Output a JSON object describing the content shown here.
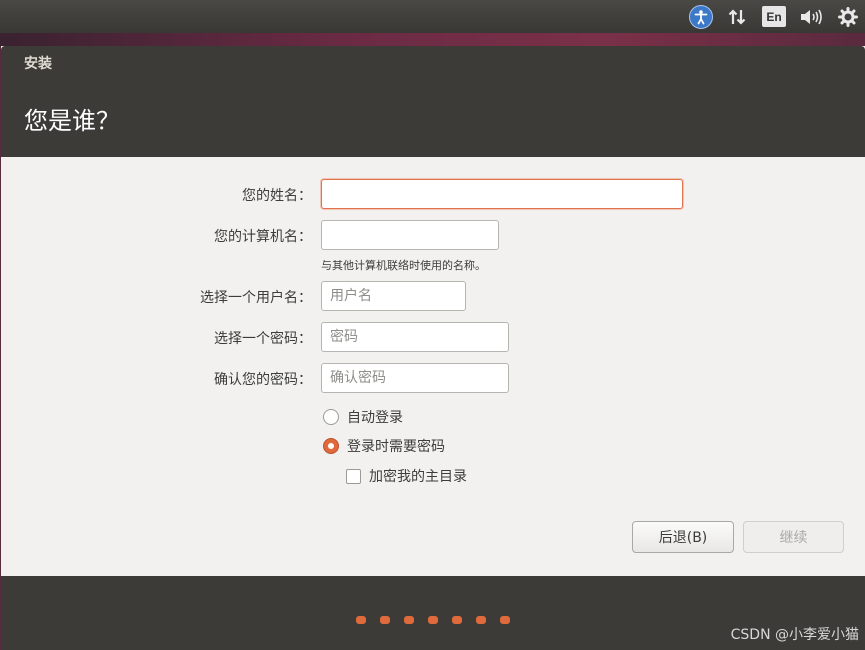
{
  "panel": {
    "keyboard_layout": "En",
    "icons": [
      "accessibility-icon",
      "network-icon",
      "keyboard-icon",
      "volume-icon",
      "gear-icon"
    ]
  },
  "window": {
    "title": "安装",
    "page_title": "您是谁？"
  },
  "form": {
    "name_label": "您的姓名：",
    "name_value": "",
    "computer_label": "您的计算机名：",
    "computer_value": "",
    "computer_hint": "与其他计算机联络时使用的名称。",
    "username_label": "选择一个用户名：",
    "username_placeholder": "用户名",
    "password_label": "选择一个密码：",
    "password_placeholder": "密码",
    "confirm_label": "确认您的密码：",
    "confirm_placeholder": "确认密码"
  },
  "options": {
    "auto_login": "自动登录",
    "require_password": "登录时需要密码",
    "encrypt_home": "加密我的主目录",
    "selected": "require_password",
    "encrypt_checked": false
  },
  "buttons": {
    "back": "后退(B)",
    "continue": "继续"
  },
  "progress": {
    "total_steps": 7,
    "dot_color": "#df6a3b"
  },
  "watermark": "CSDN @小李爱小猫",
  "colors": {
    "accent": "#e06a3c",
    "header_bg": "#3c3b37",
    "content_bg": "#f2f1f0"
  }
}
